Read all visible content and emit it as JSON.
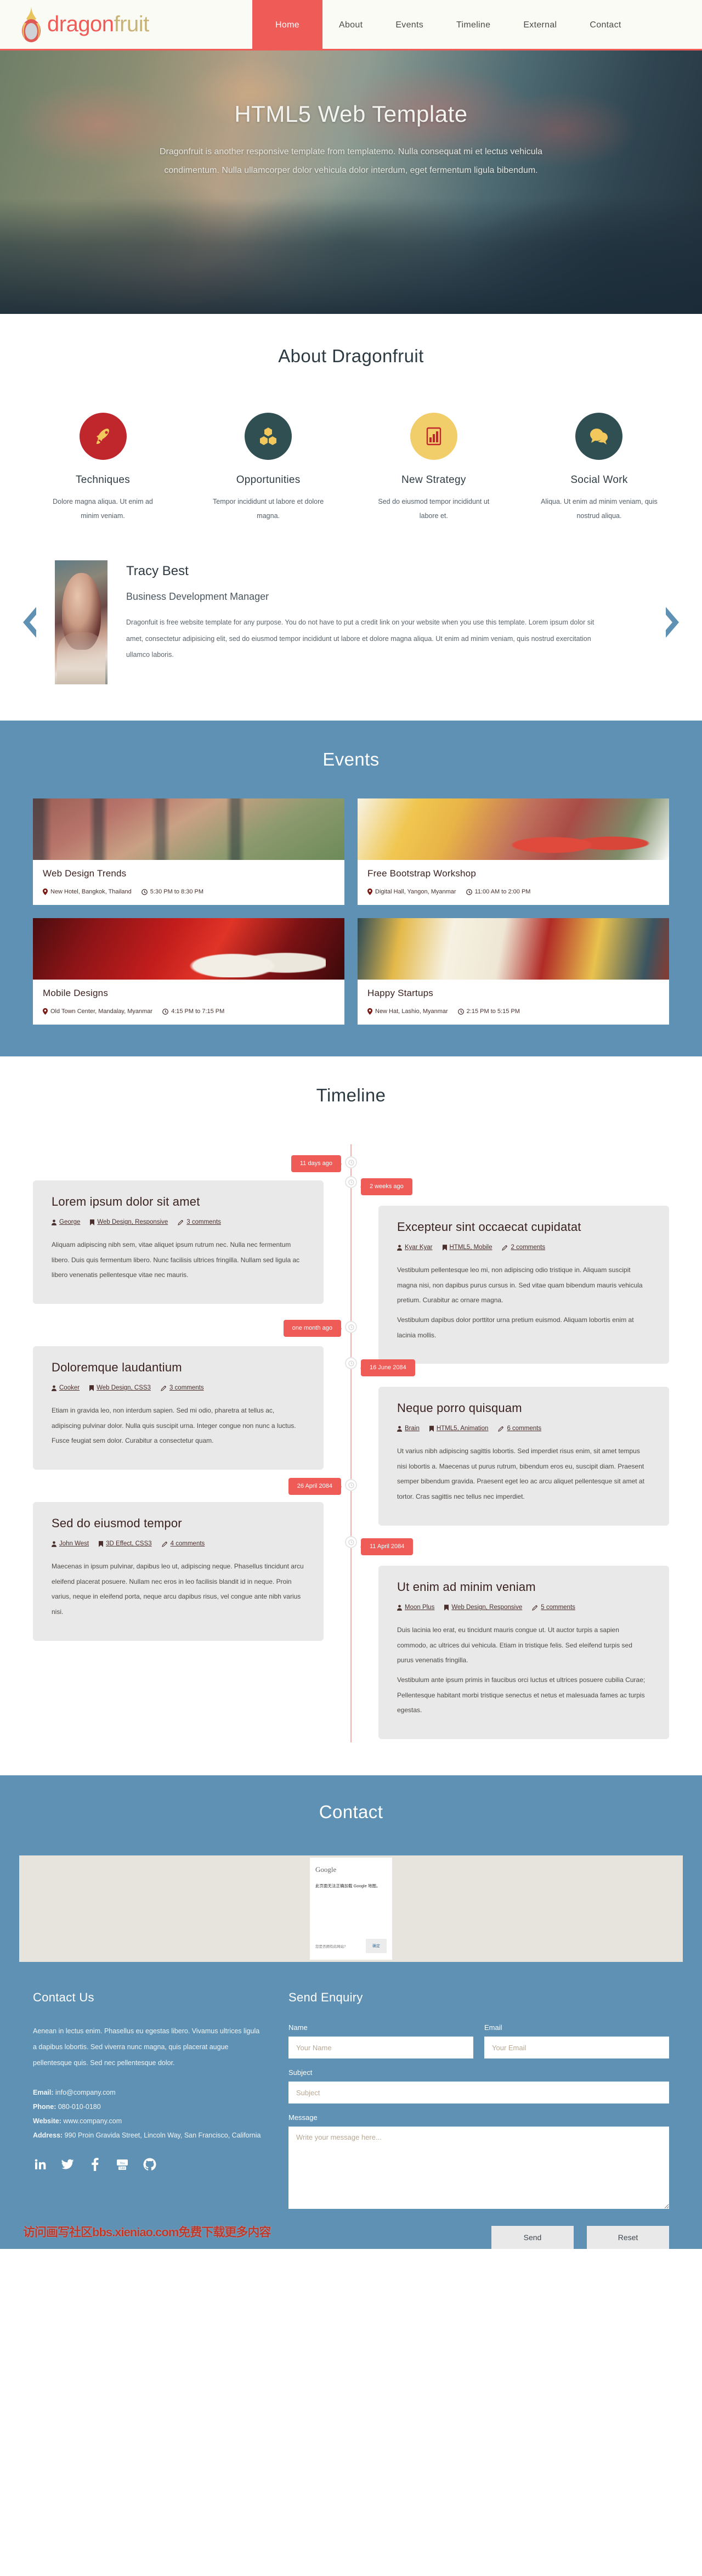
{
  "header": {
    "brand_first": "dragon",
    "brand_second": "fruit",
    "nav": [
      {
        "label": "Home",
        "active": true
      },
      {
        "label": "About",
        "active": false
      },
      {
        "label": "Events",
        "active": false
      },
      {
        "label": "Timeline",
        "active": false
      },
      {
        "label": "External",
        "active": false
      },
      {
        "label": "Contact",
        "active": false
      }
    ]
  },
  "hero": {
    "title": "HTML5 Web Template",
    "subtitle": "Dragonfruit is another responsive template from templatemo. Nulla consequat mi et lectus vehicula condimentum. Nulla ullamcorper dolor vehicula dolor interdum, eget fermentum ligula bibendum."
  },
  "about": {
    "title": "About Dragonfruit",
    "items": [
      {
        "icon": "rocket-icon",
        "name": "Techniques",
        "desc": "Dolore magna aliqua. Ut enim ad minim veniam.",
        "circle_color": "#c0272d",
        "icon_color": "#f2c75c"
      },
      {
        "icon": "cubes-icon",
        "name": "Opportunities",
        "desc": "Tempor incididunt ut labore et dolore magna.",
        "circle_color": "#2f4f53",
        "icon_color": "#f2c75c"
      },
      {
        "icon": "chart-icon",
        "name": "New Strategy",
        "desc": "Sed do eiusmod tempor incididunt ut labore et.",
        "circle_color": "#f2ce6b",
        "icon_color": "#c0272d"
      },
      {
        "icon": "comment-icon",
        "name": "Social Work",
        "desc": "Aliqua. Ut enim ad minim veniam, quis nostrud aliqua.",
        "circle_color": "#2f4f53",
        "icon_color": "#f2c75c"
      }
    ]
  },
  "testimonial": {
    "name": "Tracy Best",
    "role": "Business Development Manager",
    "text": "Dragonfuit is free website template for any purpose. You do not have to put a credit link on your website when you use this template. Lorem ipsum dolor sit amet, consectetur adipisicing elit, sed do eiusmod tempor incididunt ut labore et dolore magna aliqua. Ut enim ad minim veniam, quis nostrud exercitation ullamco laboris.",
    "prev_label": "Previous",
    "next_label": "Next"
  },
  "events": {
    "title": "Events",
    "items": [
      {
        "title": "Web Design Trends",
        "location": "New Hotel, Bangkok, Thailand",
        "time": "5:30 PM to 8:30 PM"
      },
      {
        "title": "Free Bootstrap Workshop",
        "location": "Digital Hall, Yangon, Myanmar",
        "time": "11:00 AM to 2:00 PM"
      },
      {
        "title": "Mobile Designs",
        "location": "Old Town Center, Mandalay, Myanmar",
        "time": "4:15 PM to 7:15 PM"
      },
      {
        "title": "Happy Startups",
        "location": "New Hat, Lashio, Myanmar",
        "time": "2:15 PM to 5:15 PM"
      }
    ]
  },
  "timeline": {
    "title": "Timeline",
    "items": [
      {
        "side": "left",
        "badge": "11 days ago",
        "title": "Lorem ipsum dolor sit amet",
        "author": "George",
        "tags": "Web Design, Responsive",
        "comments": "3 comments",
        "paragraphs": [
          "Aliquam adipiscing nibh sem, vitae aliquet ipsum rutrum nec. Nulla nec fermentum libero. Duis quis fermentum libero. Nunc facilisis ultrices fringilla. Nullam sed ligula ac libero venenatis pellentesque vitae nec mauris."
        ]
      },
      {
        "side": "right",
        "badge": "2 weeks ago",
        "title": "Excepteur sint occaecat cupidatat",
        "author": "Kyar Kyar",
        "tags": "HTML5, Mobile",
        "comments": "2 comments",
        "paragraphs": [
          "Vestibulum pellentesque leo mi, non adipiscing odio tristique in. Aliquam suscipit magna nisi, non dapibus purus cursus in. Sed vitae quam bibendum mauris vehicula pretium. Curabitur ac ornare magna.",
          "Vestibulum dapibus dolor porttitor urna pretium euismod. Aliquam lobortis enim at lacinia mollis."
        ]
      },
      {
        "side": "left",
        "badge": "one month ago",
        "title": "Doloremque laudantium",
        "author": "Cooker",
        "tags": "Web Design, CSS3",
        "comments": "3 comments",
        "paragraphs": [
          "Etiam in gravida leo, non interdum sapien. Sed mi odio, pharetra at tellus ac, adipiscing pulvinar dolor. Nulla quis suscipit urna. Integer congue non nunc a luctus. Fusce feugiat sem dolor. Curabitur a consectetur quam."
        ]
      },
      {
        "side": "right",
        "badge": "16 June 2084",
        "title": "Neque porro quisquam",
        "author": "Brain",
        "tags": "HTML5, Animation",
        "comments": "6 comments",
        "paragraphs": [
          "Ut varius nibh adipiscing sagittis lobortis. Sed imperdiet risus enim, sit amet tempus nisi lobortis a. Maecenas ut purus rutrum, bibendum eros eu, suscipit diam. Praesent semper bibendum gravida. Praesent eget leo ac arcu aliquet pellentesque sit amet at tortor. Cras sagittis nec tellus nec imperdiet."
        ]
      },
      {
        "side": "left",
        "badge": "26 April 2084",
        "title": "Sed do eiusmod tempor",
        "author": "John West",
        "tags": "3D Effect, CSS3",
        "comments": "4 comments",
        "paragraphs": [
          "Maecenas in ipsum pulvinar, dapibus leo ut, adipiscing neque. Phasellus tincidunt arcu eleifend placerat posuere. Nullam nec eros in leo facilisis blandit id in neque. Proin varius, neque in eleifend porta, neque arcu dapibus risus, vel congue ante nibh varius nisi."
        ]
      },
      {
        "side": "right",
        "badge": "11 April 2084",
        "title": "Ut enim ad minim veniam",
        "author": "Moon Plus",
        "tags": "Web Design, Responsive",
        "comments": "5 comments",
        "paragraphs": [
          "Duis lacinia leo erat, eu tincidunt mauris congue ut. Ut auctor turpis a sapien commodo, ac ultrices dui vehicula. Etiam in tristique felis. Sed eleifend turpis sed purus venenatis fringilla.",
          "Vestibulum ante ipsum primis in faucibus orci luctus et ultrices posuere cubilia Curae; Pellentesque habitant morbi tristique senectus et netus et malesuada fames ac turpis egestas."
        ]
      }
    ]
  },
  "contact": {
    "title": "Contact",
    "map_dialog": {
      "logo": "Google",
      "message": "此页面无法正确加载 Google 地图。",
      "own_site": "您是否拥有此网站?",
      "ok_button": "确定"
    }
  },
  "footer": {
    "contact_title": "Contact Us",
    "contact_text": "Aenean in lectus enim. Phasellus eu egestas libero. Vivamus ultrices ligula a dapibus lobortis. Sed viverra nunc magna, quis placerat augue pellentesque quis. Sed nec pellentesque dolor.",
    "email_label": "Email:",
    "email_value": "info@company.com",
    "phone_label": "Phone:",
    "phone_value": "080-010-0180",
    "website_label": "Website:",
    "website_value": "www.company.com",
    "address_label": "Address:",
    "address_value": "990 Proin Gravida Street, Lincoln Way, San Francisco, California",
    "socials": [
      "linkedin-icon",
      "twitter-icon",
      "facebook-icon",
      "youtube-icon",
      "github-icon"
    ],
    "form": {
      "title": "Send Enquiry",
      "name_label": "Name",
      "name_placeholder": "Your Name",
      "email_label": "Email",
      "email_placeholder": "Your Email",
      "subject_label": "Subject",
      "subject_placeholder": "Subject",
      "message_label": "Message",
      "message_placeholder": "Write your message here...",
      "send_label": "Send",
      "reset_label": "Reset"
    }
  },
  "watermark": "访问画写社区bbs.xieniao.com免费下载更多内容"
}
